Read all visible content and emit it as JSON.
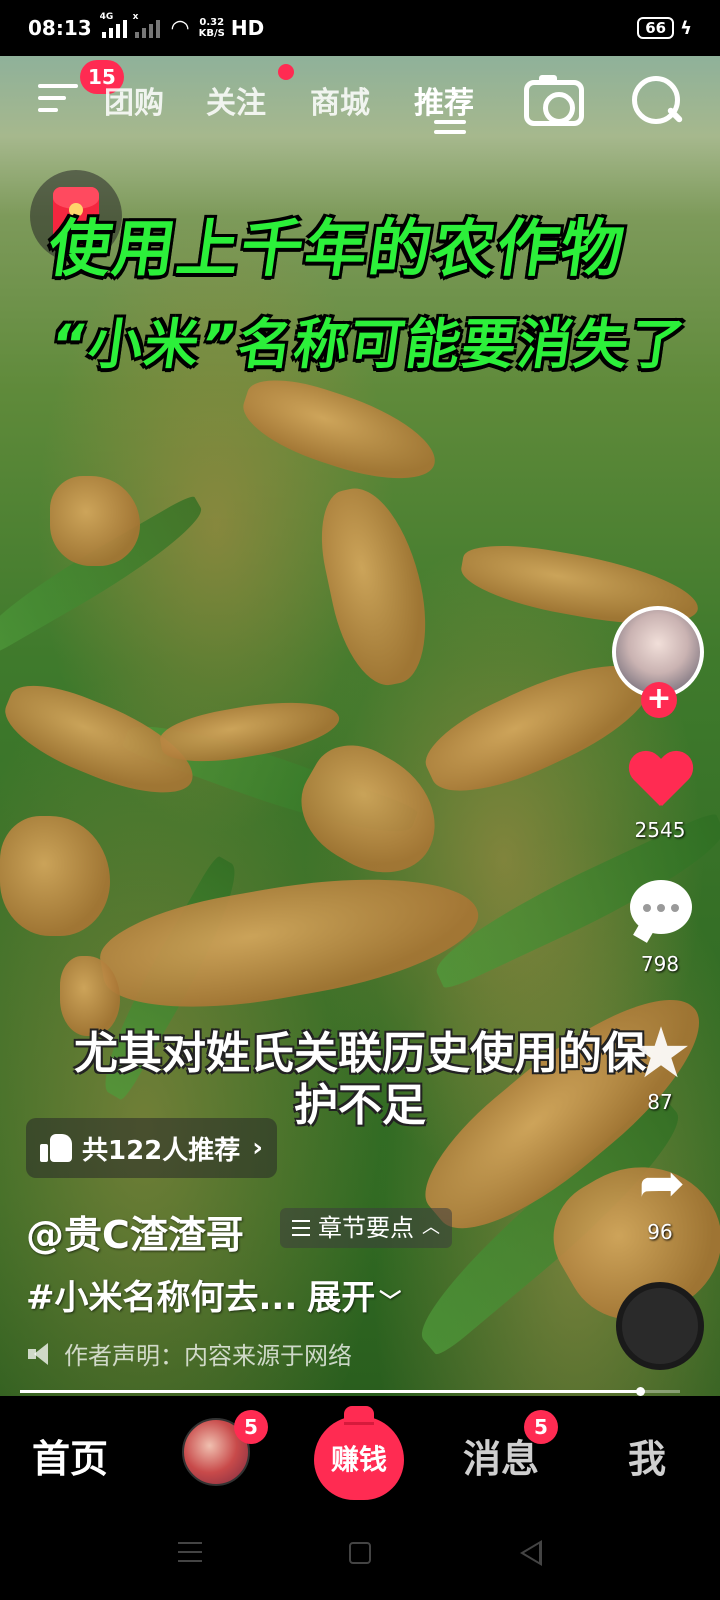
{
  "status_bar": {
    "time": "08:13",
    "network_1": "4G",
    "network_2": "x",
    "speed_value": "0.32",
    "speed_unit": "KB/S",
    "hd": "HD",
    "battery": "66"
  },
  "top_nav": {
    "menu_badge": "15",
    "tabs": [
      {
        "label": "团购"
      },
      {
        "label": "关注"
      },
      {
        "label": "商城"
      },
      {
        "label": "推荐"
      }
    ],
    "active_tab": "推荐"
  },
  "video": {
    "title_line1": "使用上千年的农作物",
    "title_line2": "“小米”名称可能要消失了",
    "subtitle": "尤其对姓氏关联历史使用的保护不足"
  },
  "actions": {
    "likes": "2545",
    "comments": "798",
    "favorites": "87",
    "shares": "96"
  },
  "info": {
    "recommend": "共122人推荐",
    "author": "@贵C渣渣哥",
    "chapter": "章节要点",
    "description": "#小米名称何去...",
    "expand": "展开",
    "disclaimer": "作者声明：内容来源于网络"
  },
  "progress": 0.94,
  "tab_bar": {
    "home": "首页",
    "friends_badge": "5",
    "earn": "赚钱",
    "messages": "消息",
    "messages_badge": "5",
    "me": "我"
  },
  "colors": {
    "accent": "#ff2b52",
    "title_green": "#2cf03a"
  }
}
